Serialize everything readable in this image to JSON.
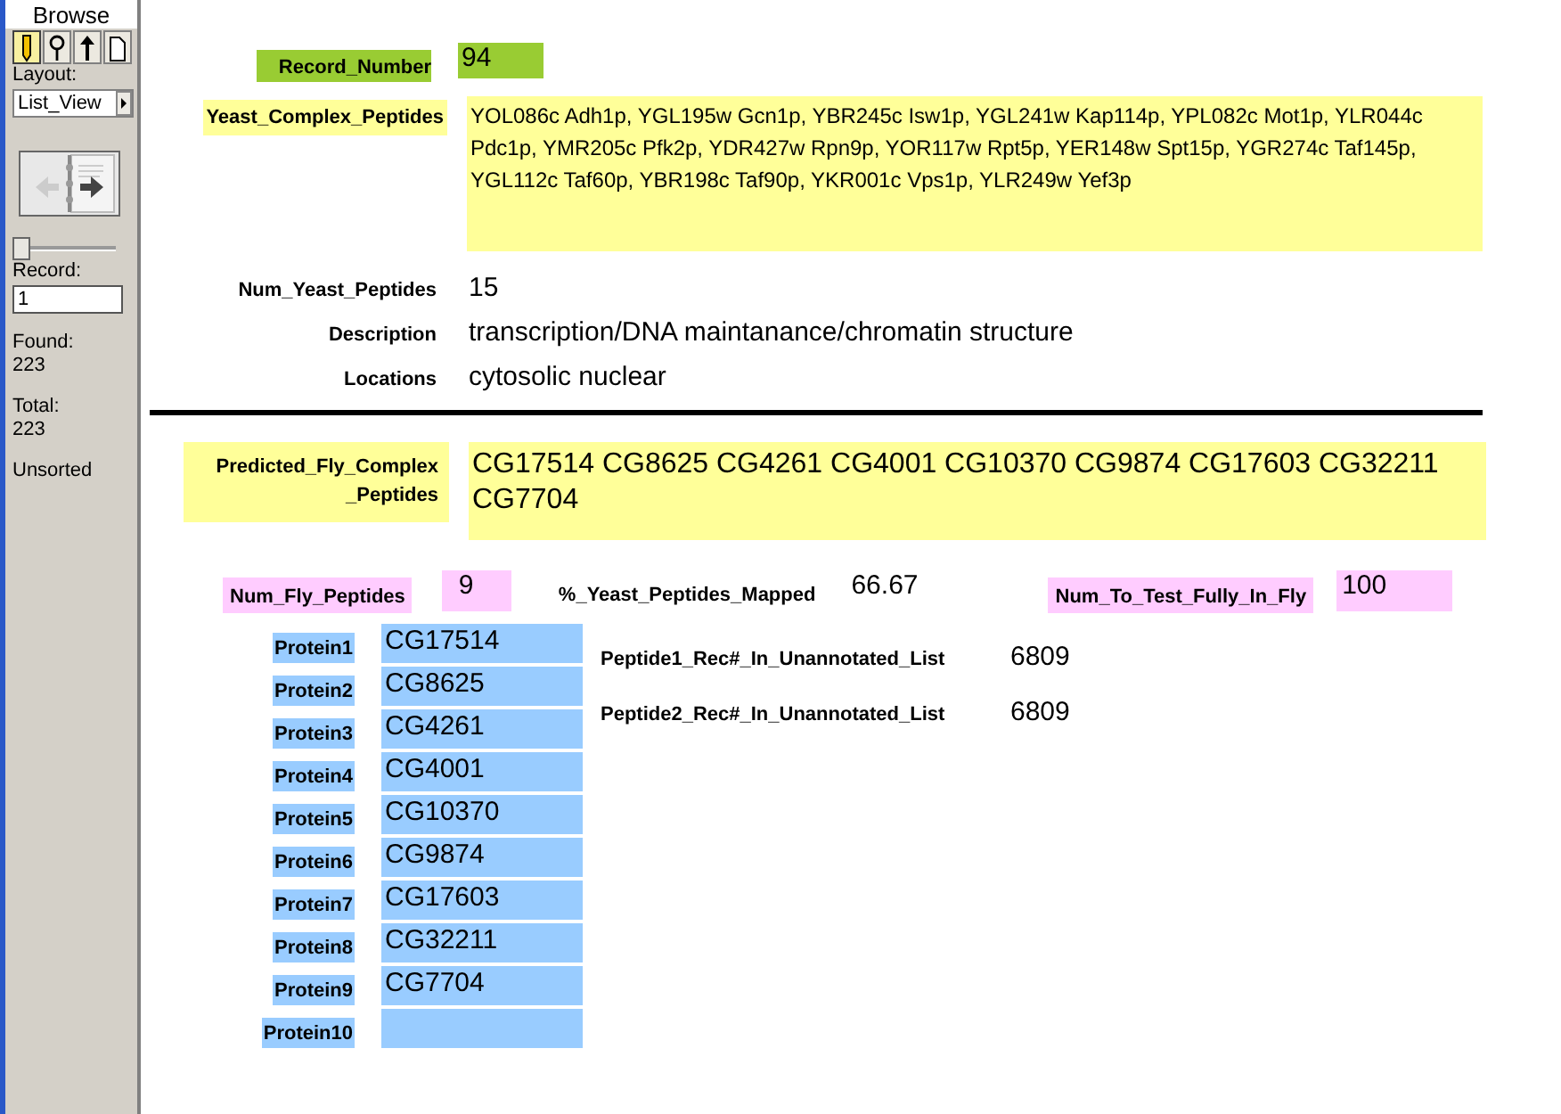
{
  "sidebar": {
    "mode_title": "Browse",
    "modes": [
      {
        "kind": "browse",
        "selected": true
      },
      {
        "kind": "find",
        "selected": false
      },
      {
        "kind": "sort",
        "selected": false
      },
      {
        "kind": "preview",
        "selected": false
      }
    ],
    "layout_label": "Layout:",
    "layout_value": "List_View",
    "slider": {
      "level": 0
    },
    "record_label": "Record:",
    "record_value": "1",
    "found_label": "Found:",
    "found_value": "223",
    "total_label": "Total:",
    "total_value": "223",
    "sort_status": "Unsorted"
  },
  "record_number": {
    "label": "Record_Number",
    "value": "94"
  },
  "yeast_complex_peptides": {
    "label": "Yeast_Complex_Peptides",
    "value": "YOL086c Adh1p, YGL195w Gcn1p, YBR245c Isw1p, YGL241w Kap114p, YPL082c Mot1p, YLR044c Pdc1p, YMR205c Pfk2p, YDR427w Rpn9p, YOR117w Rpt5p, YER148w Spt15p, YGR274c Taf145p, YGL112c Taf60p, YBR198c Taf90p, YKR001c Vps1p, YLR249w Yef3p"
  },
  "yeast_info": [
    {
      "label": "Num_Yeast_Peptides",
      "value": "15"
    },
    {
      "label": "Description",
      "value": "transcription/DNA maintanance/chromatin structure"
    },
    {
      "label": "Locations",
      "value": "cytosolic nuclear"
    }
  ],
  "predicted_fly_complex_peptides": {
    "label": "Predicted_Fly_Complex _Peptides",
    "value": "CG17514 CG8625 CG4261 CG4001 CG10370 CG9874 CG17603 CG32211 CG7704"
  },
  "num_fly_peptides": {
    "label": "Num_Fly_Peptides",
    "value": "9"
  },
  "yeast_peptides_mapped": {
    "label": "%_Yeast_Peptides_Mapped",
    "value": "66.67"
  },
  "num_to_test_fully_in_fly": {
    "label": "Num_To_Test_Fully_In_Fly",
    "value": "100"
  },
  "proteins": [
    {
      "label": "Protein1",
      "value": "CG17514"
    },
    {
      "label": "Protein2",
      "value": "CG8625"
    },
    {
      "label": "Protein3",
      "value": "CG4261"
    },
    {
      "label": "Protein4",
      "value": "CG4001"
    },
    {
      "label": "Protein5",
      "value": "CG10370"
    },
    {
      "label": "Protein6",
      "value": "CG9874"
    },
    {
      "label": "Protein7",
      "value": "CG17603"
    },
    {
      "label": "Protein8",
      "value": "CG32211"
    },
    {
      "label": "Protein9",
      "value": "CG7704"
    },
    {
      "label": "Protein10"
    }
  ],
  "peptide_recs": [
    {
      "label": "Peptide1_Rec#_In_Unannotated_List",
      "value": "6809"
    },
    {
      "label": "Peptide2_Rec#_In_Unannotated_List",
      "value": "6809"
    }
  ]
}
